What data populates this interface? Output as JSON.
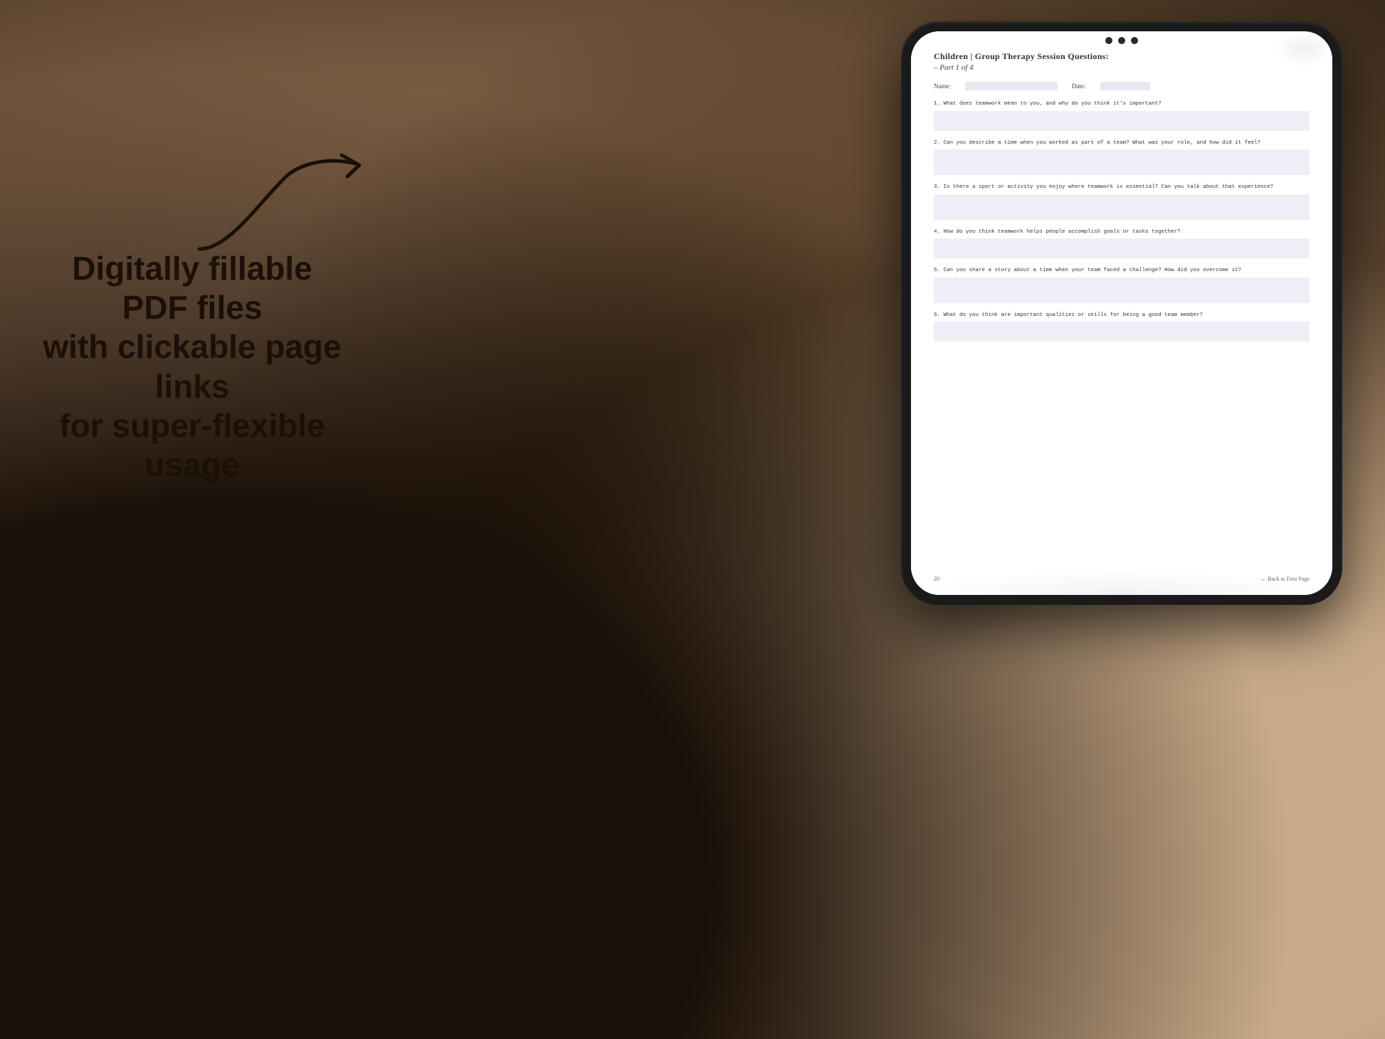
{
  "background": {
    "color_main": "#a08070"
  },
  "left_text": {
    "tagline_line1": "Digitally fillable PDF files",
    "tagline_line2": "with clickable page links",
    "tagline_line3": "for super-flexible usage"
  },
  "arrow": {
    "description": "curved arrow pointing right toward tablet"
  },
  "tablet": {
    "title": "Children | Group Therapy Session Questions:",
    "subtitle": "– Part 1 of 4",
    "name_label": "Name:",
    "date_label": "Date:",
    "questions": [
      {
        "number": "1.",
        "text": "What does teamwork mean to you, and why do you think it's important?"
      },
      {
        "number": "2.",
        "text": "Can you describe a time when you worked as part of a team? What was your role, and how did it feel?"
      },
      {
        "number": "3.",
        "text": "Is there a sport or activity you enjoy where teamwork is essential? Can you talk about that experience?"
      },
      {
        "number": "4.",
        "text": "How do you think teamwork helps people accomplish goals or tasks together?"
      },
      {
        "number": "5.",
        "text": "Can you share a story about a time when your team faced a challenge? How did you overcome it?"
      },
      {
        "number": "6.",
        "text": "What do you think are important qualities or skills for being a good team member?"
      }
    ],
    "footer": {
      "page_number": "20",
      "back_link_text": "← Back to First Page"
    }
  }
}
